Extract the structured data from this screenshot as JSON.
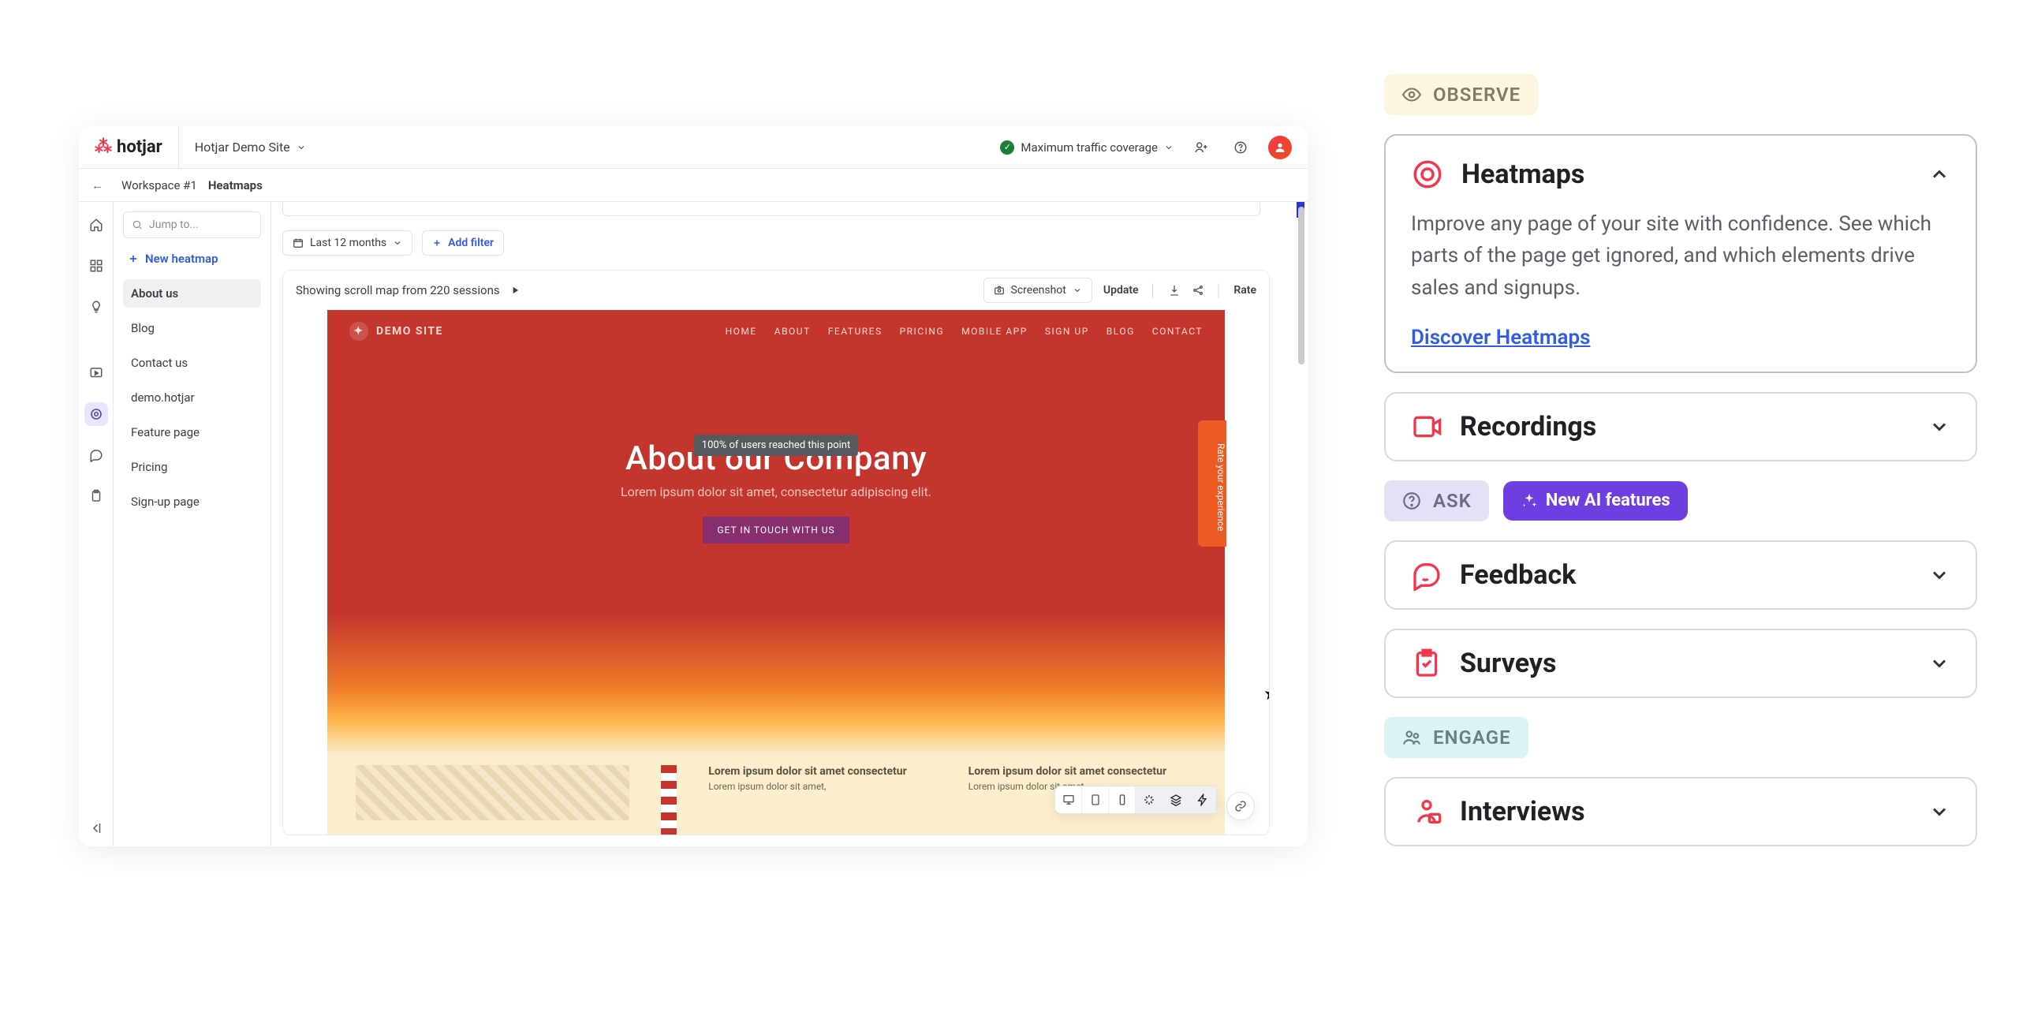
{
  "topbar": {
    "brand": "hotjar",
    "site": "Hotjar Demo Site",
    "traffic": "Maximum traffic coverage"
  },
  "breadcrumb": {
    "workspace": "Workspace #1",
    "section": "Heatmaps"
  },
  "sidebar": {
    "search_placeholder": "Jump to...",
    "new_label": "New heatmap",
    "items": [
      "About us",
      "Blog",
      "Contact us",
      "demo.hotjar",
      "Feature page",
      "Pricing",
      "Sign-up page"
    ]
  },
  "filters": {
    "range": "Last 12 months",
    "add": "Add filter"
  },
  "panel": {
    "title": "Showing scroll map from 220 sessions",
    "screenshot": "Screenshot",
    "update": "Update",
    "rate": "Rate"
  },
  "demo": {
    "site": "DEMO SITE",
    "nav": [
      "HOME",
      "ABOUT",
      "FEATURES",
      "PRICING",
      "MOBILE APP",
      "SIGN UP",
      "BLOG",
      "CONTACT"
    ],
    "hero_title": "About our Company",
    "hero_sub": "Lorem ipsum dolor sit amet, consectetur adipiscing elit.",
    "hero_cta": "GET IN TOUCH WITH US",
    "reach_tag": "100% of users reached this point",
    "rate_tab": "Rate your experience",
    "lorem_h": "Lorem ipsum dolor sit amet consectetur",
    "lorem_p": "Lorem ipsum dolor sit amet,"
  },
  "right": {
    "observe": "OBSERVE",
    "ask": "ASK",
    "ai": "New AI features",
    "engage": "ENGAGE",
    "heatmaps": {
      "title": "Heatmaps",
      "body": "Improve any page of your site with confidence. See which parts of the page get ignored, and which elements drive sales and signups.",
      "link": "Discover Heatmaps"
    },
    "recordings": "Recordings",
    "feedback": "Feedback",
    "surveys": "Surveys",
    "interviews": "Interviews"
  }
}
